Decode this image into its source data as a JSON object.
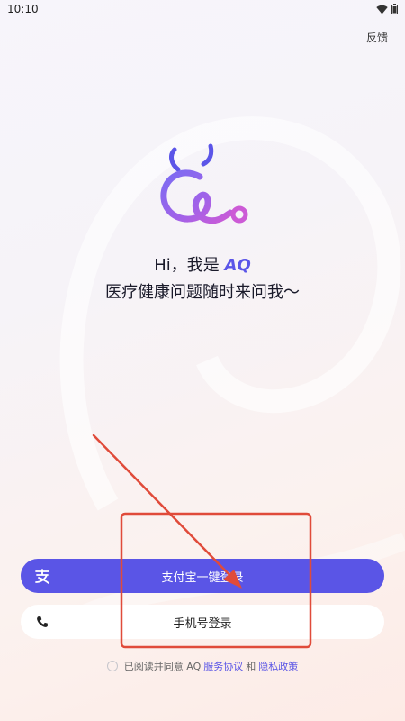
{
  "status": {
    "time": "10:10"
  },
  "header": {
    "feedback": "反馈"
  },
  "hero": {
    "greeting_prefix": "Hi，我是 ",
    "brand": "AQ",
    "subtitle": "医疗健康问题随时来问我～"
  },
  "buttons": {
    "alipay_label": "支付宝一键登录",
    "alipay_icon": "alipay-icon",
    "phone_label": "手机号登录",
    "phone_icon": "phone-icon"
  },
  "terms": {
    "prefix": "已阅读并同意 AQ",
    "service": "服务协议",
    "and": "和",
    "privacy": "隐私政策"
  },
  "colors": {
    "accent": "#5a55e6",
    "annotation": "#e04b3a"
  }
}
